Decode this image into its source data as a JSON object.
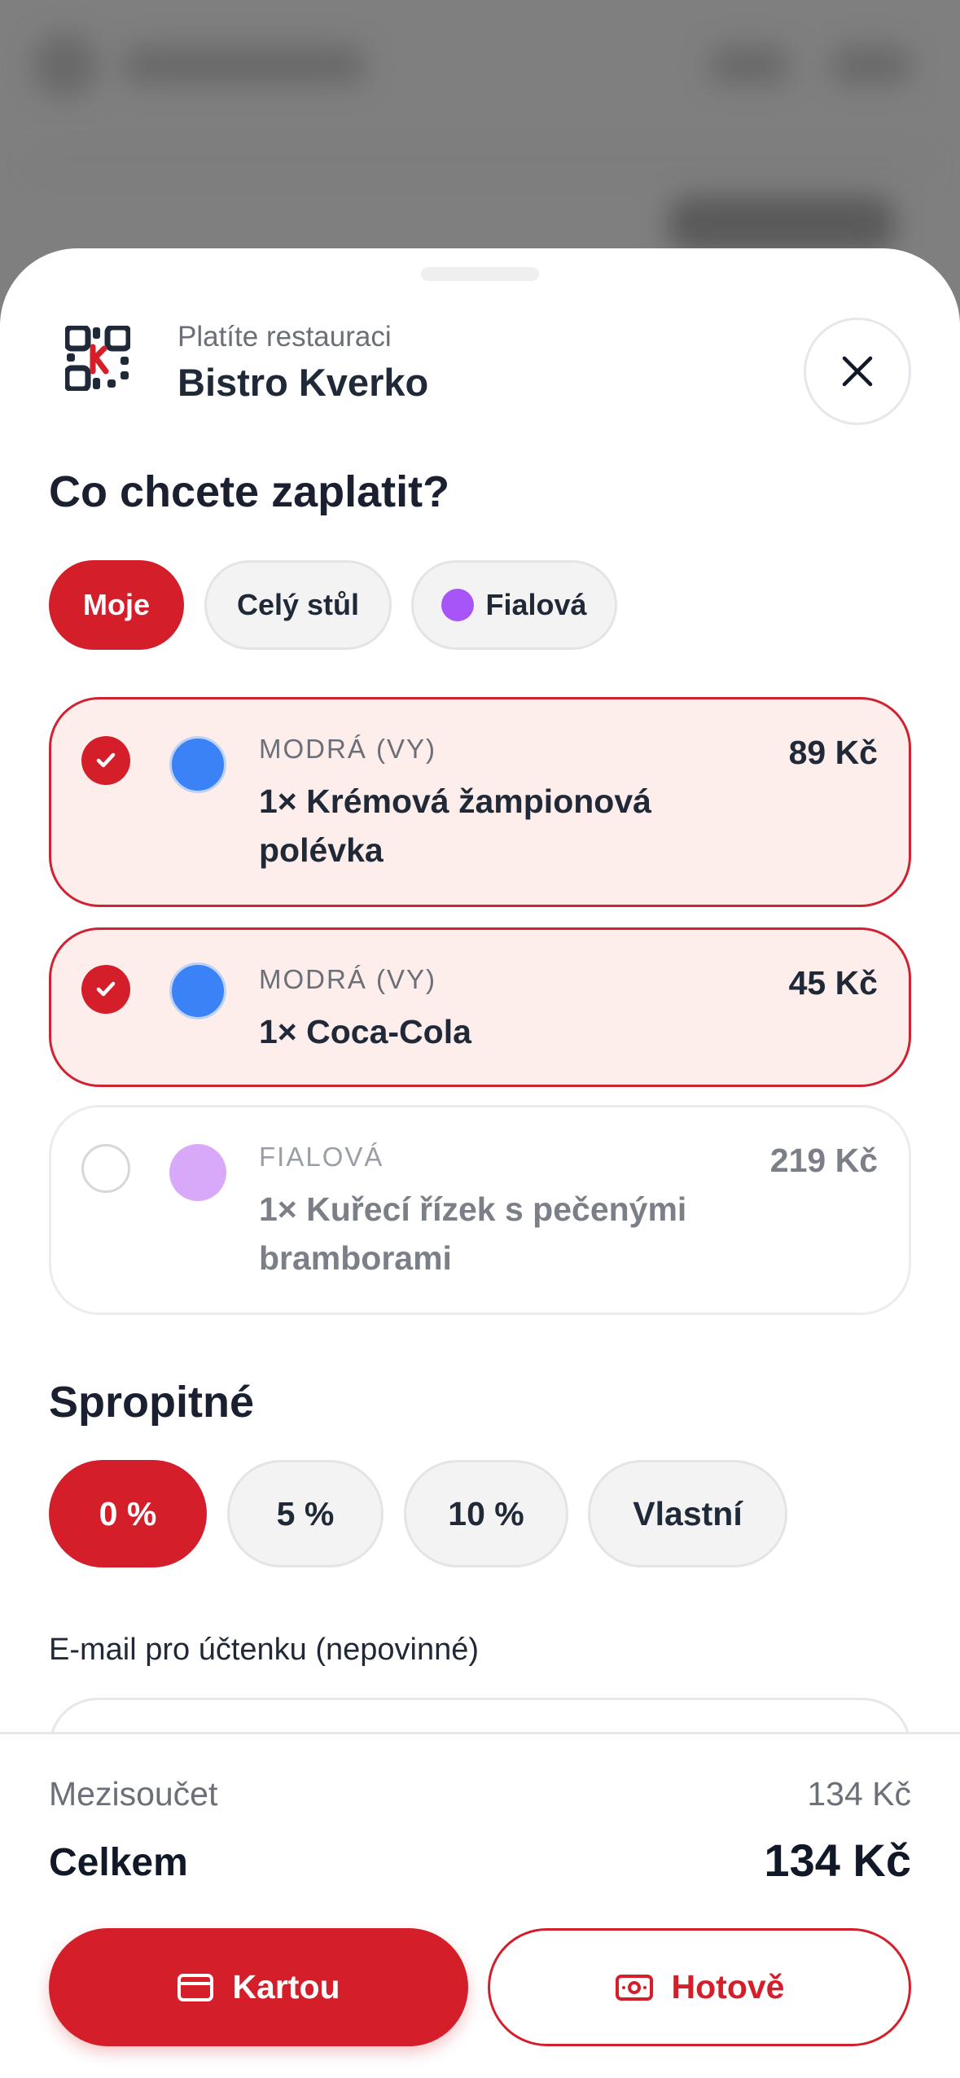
{
  "header": {
    "subtitle": "Platíte restauraci",
    "restaurant_name": "Bistro Kverko"
  },
  "question": "Co chcete zaplatit?",
  "filters": [
    {
      "label": "Moje",
      "active": true
    },
    {
      "label": "Celý stůl",
      "active": false
    },
    {
      "label": "Fialová",
      "active": false,
      "color": "#a855f7"
    }
  ],
  "items": [
    {
      "owner": "MODRÁ (VY)",
      "name": "1× Krémová žampionová polévka",
      "price": "89 Kč",
      "selected": true,
      "color": "#3b82f6"
    },
    {
      "owner": "MODRÁ (VY)",
      "name": "1× Coca-Cola",
      "price": "45 Kč",
      "selected": true,
      "color": "#3b82f6"
    },
    {
      "owner": "FIALOVÁ",
      "name": "1× Kuřecí řízek s pečenými bramborami",
      "price": "219 Kč",
      "selected": false,
      "color": "#d8a9f8"
    }
  ],
  "tip": {
    "heading": "Spropitné",
    "options": [
      {
        "label": "0 %",
        "active": true
      },
      {
        "label": "5 %",
        "active": false
      },
      {
        "label": "10 %",
        "active": false
      },
      {
        "label": "Vlastní",
        "active": false
      }
    ]
  },
  "email": {
    "label": "E-mail pro účtenku (nepovinné)"
  },
  "summary": {
    "subtotal_label": "Mezisoučet",
    "subtotal_value": "134 Kč",
    "total_label": "Celkem",
    "total_value": "134 Kč"
  },
  "payment": {
    "card_label": "Kartou",
    "cash_label": "Hotově"
  },
  "colors": {
    "accent": "#d41f2b",
    "selected_bg": "#fdedeb"
  }
}
